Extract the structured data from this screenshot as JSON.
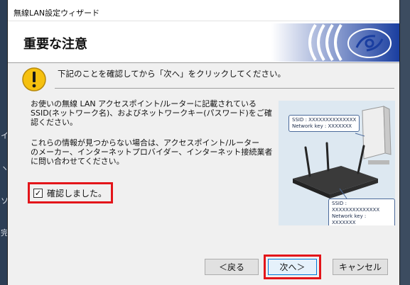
{
  "window": {
    "title": "無線LAN設定ウィザード"
  },
  "header": {
    "title": "重要な注意"
  },
  "instruction": "下記のことを確認してから「次へ」をクリックしてください。",
  "body": {
    "p1_line1": "お使いの無線 LAN アクセスポイント/ルーターに記載されている",
    "p1_line2": "SSID(ネットワーク名)、およびネットワークキー(パスワード)をご確",
    "p1_line3": "認ください。",
    "p2_line1": "これらの情報が見つからない場合は、アクセスポイント/ルーター",
    "p2_line2": "のメーカー、インターネットプロバイダー、インターネット接続業者",
    "p2_line3": "に問い合わせてください。"
  },
  "confirm": {
    "label": "確認しました。",
    "checked": true
  },
  "illustration": {
    "card_top": {
      "ssid": "SSID : XXXXXXXXXXXXXX",
      "key": "Network key : XXXXXXX"
    },
    "card_bottom": {
      "ssid": "SSID : XXXXXXXXXXXXXX",
      "key": "Network key : XXXXXXX"
    }
  },
  "buttons": {
    "back": "＜戻る",
    "next": "次へ＞",
    "cancel": "キャンセル"
  },
  "background_glyphs": {
    "left": [
      "イ",
      "ヽ",
      "ソ",
      "完"
    ],
    "right": [
      "",
      "",
      "",
      ""
    ]
  },
  "colors": {
    "highlight": "#e3151a",
    "logo_blue": "#1a3ea0"
  }
}
